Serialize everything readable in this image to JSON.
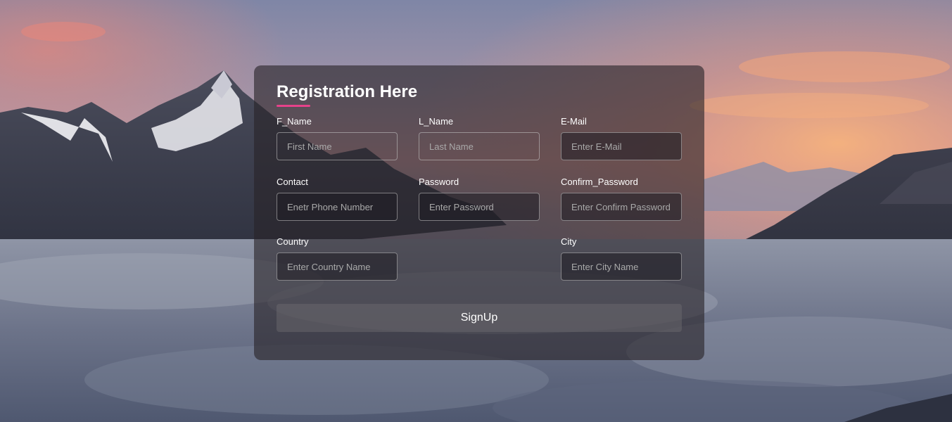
{
  "form": {
    "title": "Registration Here",
    "accent_color": "#e6428a",
    "fields": {
      "first_name": {
        "label": "F_Name",
        "placeholder": "First Name"
      },
      "last_name": {
        "label": "L_Name",
        "placeholder": "Last Name"
      },
      "email": {
        "label": "E-Mail",
        "placeholder": "Enter E-Mail"
      },
      "contact": {
        "label": "Contact",
        "placeholder": "Enetr Phone Number"
      },
      "password": {
        "label": "Password",
        "placeholder": "Enter Password"
      },
      "confirm_password": {
        "label": "Confirm_Password",
        "placeholder": "Enter Confirm Password"
      },
      "country": {
        "label": "Country",
        "placeholder": "Enter Country Name"
      },
      "city": {
        "label": "City",
        "placeholder": "Enter City Name"
      }
    },
    "submit_label": "SignUp"
  }
}
